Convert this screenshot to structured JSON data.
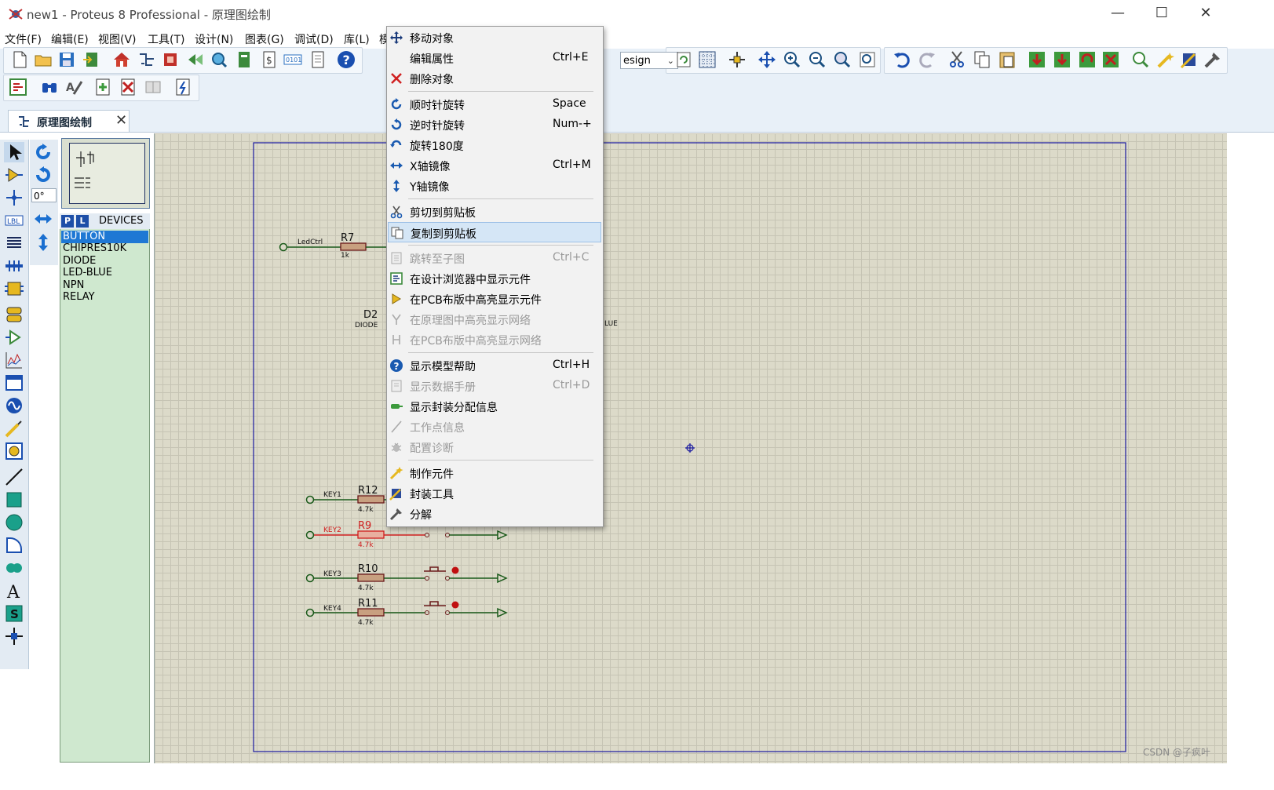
{
  "window": {
    "title": "new1 - Proteus 8 Professional - 原理图绘制",
    "minimize": "—",
    "maximize": "☐",
    "close": "✕"
  },
  "menubar": [
    {
      "label": "文件(F)"
    },
    {
      "label": "编辑(E)"
    },
    {
      "label": "视图(V)"
    },
    {
      "label": "工具(T)"
    },
    {
      "label": "设计(N)"
    },
    {
      "label": "图表(G)"
    },
    {
      "label": "调试(D)"
    },
    {
      "label": "库(L)"
    },
    {
      "label": "模"
    }
  ],
  "toolbar": {
    "design_select": "esign"
  },
  "tab": {
    "label": "原理图绘制",
    "close": "✕"
  },
  "rotation": {
    "angle": "0°"
  },
  "devices": {
    "p_button": "P",
    "l_button": "L",
    "title": "DEVICES",
    "items": [
      {
        "label": "BUTTON",
        "selected": true
      },
      {
        "label": "CHIPRES10K"
      },
      {
        "label": "DIODE"
      },
      {
        "label": "LED-BLUE"
      },
      {
        "label": "NPN"
      },
      {
        "label": "RELAY"
      }
    ]
  },
  "schematic": {
    "r7": {
      "net": "LedCtrl",
      "ref": "R7",
      "value": "1k"
    },
    "d2": {
      "ref": "D2",
      "value": "DIODE",
      "partial_label": "LUE"
    },
    "r12": {
      "net": "KEY1",
      "ref": "R12",
      "value": "4.7k"
    },
    "r9": {
      "net": "KEY2",
      "ref": "R9",
      "value": "4.7k"
    },
    "r10": {
      "net": "KEY3",
      "ref": "R10",
      "value": "4.7k"
    },
    "r11": {
      "net": "KEY4",
      "ref": "R11",
      "value": "4.7k"
    }
  },
  "context_menu": [
    {
      "label": "移动对象",
      "shortcut": "",
      "icon": "move-icon",
      "disabled": false
    },
    {
      "label": "编辑属性",
      "shortcut": "Ctrl+E",
      "icon": "",
      "disabled": false
    },
    {
      "label": "删除对象",
      "shortcut": "",
      "icon": "delete-x-icon",
      "disabled": false
    },
    {
      "label": "顺时针旋转",
      "shortcut": "Space",
      "icon": "rotate-cw-icon",
      "disabled": false
    },
    {
      "label": "逆时针旋转",
      "shortcut": "Num-+",
      "icon": "rotate-ccw-icon",
      "disabled": false
    },
    {
      "label": "旋转180度",
      "shortcut": "",
      "icon": "rotate-180-icon",
      "disabled": false
    },
    {
      "label": "X轴镜像",
      "shortcut": "Ctrl+M",
      "icon": "mirror-x-icon",
      "disabled": false
    },
    {
      "label": "Y轴镜像",
      "shortcut": "",
      "icon": "mirror-y-icon",
      "disabled": false
    },
    {
      "label": "剪切到剪贴板",
      "shortcut": "",
      "icon": "scissors-icon",
      "disabled": false
    },
    {
      "label": "复制到剪贴板",
      "shortcut": "",
      "icon": "copy-icon",
      "disabled": false,
      "highlighted": true
    },
    {
      "label": "跳转至子图",
      "shortcut": "Ctrl+C",
      "icon": "subsheet-icon",
      "disabled": true
    },
    {
      "label": "在设计浏览器中显示元件",
      "shortcut": "",
      "icon": "design-explorer-icon",
      "disabled": false
    },
    {
      "label": "在PCB布版中高亮显示元件",
      "shortcut": "",
      "icon": "pcb-highlight-icon",
      "disabled": false
    },
    {
      "label": "在原理图中高亮显示网络",
      "shortcut": "",
      "icon": "net-highlight-icon",
      "disabled": true
    },
    {
      "label": "在PCB布版中高亮显示网络",
      "shortcut": "",
      "icon": "pcb-net-icon",
      "disabled": true
    },
    {
      "label": "显示模型帮助",
      "shortcut": "Ctrl+H",
      "icon": "help-icon",
      "disabled": false
    },
    {
      "label": "显示数据手册",
      "shortcut": "Ctrl+D",
      "icon": "datasheet-icon",
      "disabled": true
    },
    {
      "label": "显示封装分配信息",
      "shortcut": "",
      "icon": "package-icon",
      "disabled": false
    },
    {
      "label": "工作点信息",
      "shortcut": "",
      "icon": "probe-icon",
      "disabled": true
    },
    {
      "label": "配置诊断",
      "shortcut": "",
      "icon": "bug-icon",
      "disabled": true
    },
    {
      "label": "制作元件",
      "shortcut": "",
      "icon": "make-device-icon",
      "disabled": false
    },
    {
      "label": "封装工具",
      "shortcut": "",
      "icon": "packaging-tool-icon",
      "disabled": false
    },
    {
      "label": "分解",
      "shortcut": "",
      "icon": "decompose-icon",
      "disabled": false
    }
  ],
  "watermark": "CSDN @子疯叶"
}
